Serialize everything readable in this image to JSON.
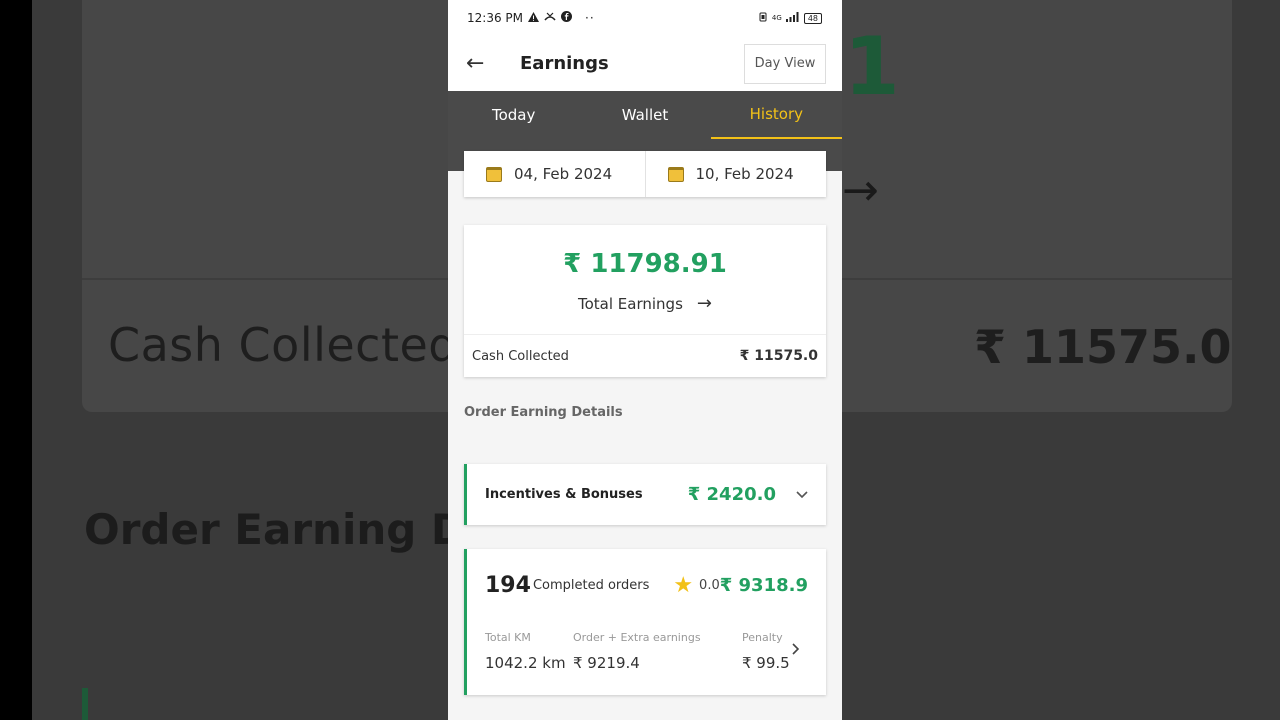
{
  "background": {
    "cash_label": "Cash Collected",
    "cash_value": "₹ 11575.0",
    "order_title": "Order Earning D",
    "big_digit": "1",
    "arrow": "→"
  },
  "status_bar": {
    "time": "12:36 PM",
    "icons": [
      "warning-icon",
      "missed-call-icon",
      "facebook-icon",
      "more-dots-icon"
    ],
    "network": "4G",
    "battery": "48"
  },
  "appbar": {
    "back_icon": "←",
    "title": "Earnings",
    "day_view": "Day View"
  },
  "tabs": [
    {
      "label": "Today",
      "active": false
    },
    {
      "label": "Wallet",
      "active": false
    },
    {
      "label": "History",
      "active": true
    }
  ],
  "date_range": {
    "start": "04, Feb 2024",
    "end": "10, Feb 2024"
  },
  "earnings": {
    "total": "₹ 11798.91",
    "total_label": "Total Earnings",
    "arrow": "→",
    "cash_label": "Cash Collected",
    "cash_value": "₹ 11575.0"
  },
  "section_title": "Order Earning Details",
  "incentives": {
    "label": "Incentives & Bonuses",
    "value": "₹ 2420.0"
  },
  "orders": {
    "count": "194",
    "label": "Completed orders",
    "rating": "0.0",
    "amount": "₹ 9318.9",
    "stats": [
      {
        "label": "Total KM",
        "value": "1042.2 km"
      },
      {
        "label": "Order + Extra earnings",
        "value": "₹ 9219.4"
      },
      {
        "label": "Penalty",
        "value": "₹ 99.5"
      }
    ]
  },
  "colors": {
    "accent_green": "#22a060",
    "tab_active": "#f2c118",
    "tab_bar": "#4a4a4a"
  }
}
